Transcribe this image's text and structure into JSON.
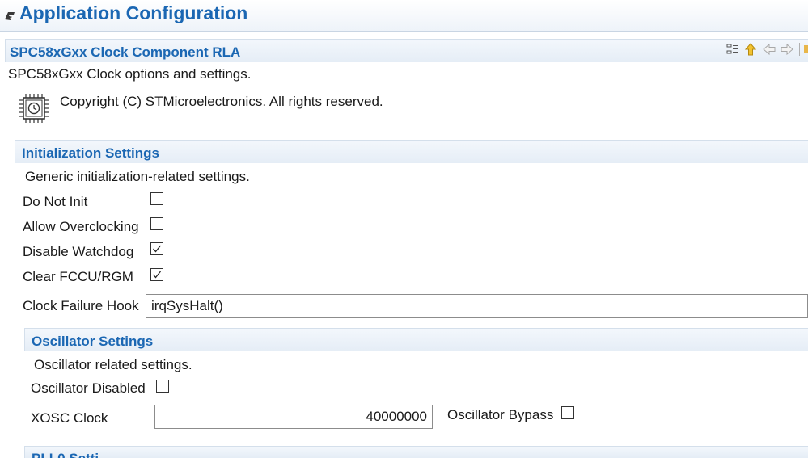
{
  "app": {
    "title": "Application Configuration"
  },
  "component": {
    "title": "SPC58xGxx Clock Component RLA",
    "description": "SPC58xGxx Clock options and settings.",
    "copyright": "Copyright (C) STMicroelectronics. All rights reserved."
  },
  "toolbar": {
    "icons": [
      "collapse-all-icon",
      "up-arrow-icon",
      "back-arrow-icon",
      "forward-arrow-icon"
    ]
  },
  "init": {
    "title": "Initialization Settings",
    "description": "Generic initialization-related settings.",
    "do_not_init": {
      "label": "Do Not Init",
      "checked": false
    },
    "allow_overclocking": {
      "label": "Allow Overclocking",
      "checked": false
    },
    "disable_watchdog": {
      "label": "Disable Watchdog",
      "checked": true
    },
    "clear_fccu": {
      "label": "Clear FCCU/RGM",
      "checked": true
    },
    "clock_failure_hook": {
      "label": "Clock Failure Hook",
      "value": "irqSysHalt()"
    }
  },
  "osc": {
    "title": "Oscillator Settings",
    "description": "Oscillator related settings.",
    "disabled": {
      "label": "Oscillator Disabled",
      "checked": false
    },
    "xosc_clock": {
      "label": "XOSC Clock",
      "value": "40000000"
    },
    "bypass": {
      "label": "Oscillator Bypass",
      "checked": false
    }
  },
  "pll0": {
    "title": "PLL0 Setti"
  },
  "colors": {
    "accent": "#1b67b3",
    "section_bg": "#e9f0f8"
  }
}
